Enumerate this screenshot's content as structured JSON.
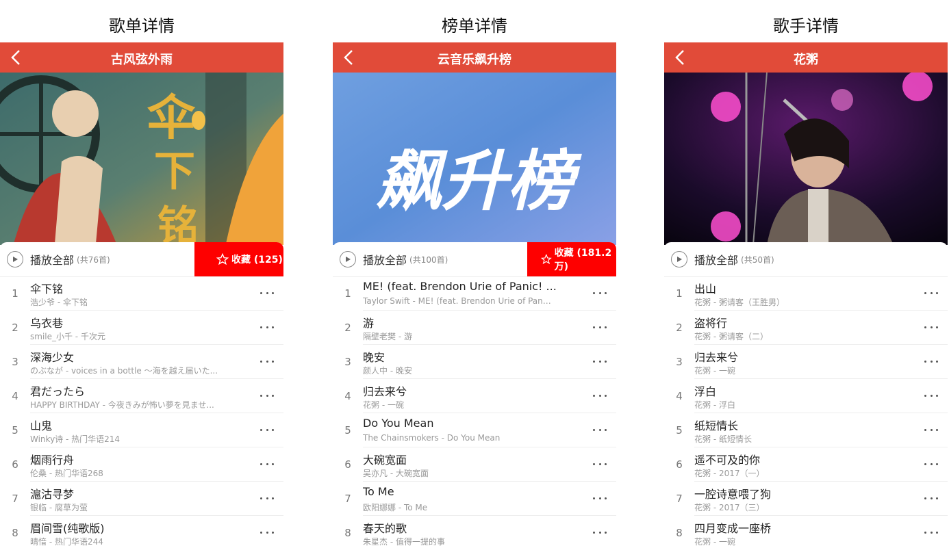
{
  "panels": [
    {
      "page_label": "歌单详情",
      "header_title": "古风弦外雨",
      "play_all_label": "播放全部",
      "count_text": "(共76首)",
      "collect_label": "收藏 (125)",
      "songs": [
        {
          "index": "1",
          "title": "伞下铭",
          "subtitle": "浩少爷 - 伞下铭"
        },
        {
          "index": "2",
          "title": "乌衣巷",
          "subtitle": "smile_小千 - 千次元"
        },
        {
          "index": "3",
          "title": "深海少女",
          "subtitle": "のぶなが - voices in a bottle ～海を越え届いた..."
        },
        {
          "index": "4",
          "title": "君だったら",
          "subtitle": "HAPPY BIRTHDAY - 今夜きみが怖い夢を見ませ..."
        },
        {
          "index": "5",
          "title": "山鬼",
          "subtitle": "Winky诗 - 热门华语214"
        },
        {
          "index": "6",
          "title": "烟雨行舟",
          "subtitle": "伦桑 - 热门华语268"
        },
        {
          "index": "7",
          "title": "滬沽寻梦",
          "subtitle": "银临 - 腐草为萤"
        },
        {
          "index": "8",
          "title": "眉间雪(纯歌版)",
          "subtitle": "晴愔 - 热门华语244"
        }
      ]
    },
    {
      "page_label": "榜单详情",
      "header_title": "云音乐飙升榜",
      "cover_text": "飙升榜",
      "play_all_label": "播放全部",
      "count_text": "(共100首)",
      "collect_label": "收藏 (181.2万)",
      "songs": [
        {
          "index": "1",
          "title": "ME! (feat. Brendon Urie of Panic! ...",
          "subtitle": "Taylor Swift - ME! (feat. Brendon Urie of Pani..."
        },
        {
          "index": "2",
          "title": "游",
          "subtitle": "隔壁老樊 - 游"
        },
        {
          "index": "3",
          "title": "晚安",
          "subtitle": "颜人中 - 晚安"
        },
        {
          "index": "4",
          "title": "归去来兮",
          "subtitle": "花粥 - 一碗"
        },
        {
          "index": "5",
          "title": "Do You Mean",
          "subtitle": "The Chainsmokers - Do You Mean"
        },
        {
          "index": "6",
          "title": "大碗宽面",
          "subtitle": "吴亦凡 - 大碗宽面"
        },
        {
          "index": "7",
          "title": "To Me",
          "subtitle": "欧阳娜娜 - To Me"
        },
        {
          "index": "8",
          "title": "春天的歌",
          "subtitle": "朱星杰 - 值得一提的事"
        }
      ]
    },
    {
      "page_label": "歌手详情",
      "header_title": "花粥",
      "play_all_label": "播放全部",
      "count_text": "(共50首)",
      "songs": [
        {
          "index": "1",
          "title": "出山",
          "subtitle": "花粥 - 粥请客（王胜男）"
        },
        {
          "index": "2",
          "title": "盗将行",
          "subtitle": "花粥 - 粥请客（二）"
        },
        {
          "index": "3",
          "title": "归去来兮",
          "subtitle": "花粥 - 一碗"
        },
        {
          "index": "4",
          "title": "浮白",
          "subtitle": "花粥 - 浮白"
        },
        {
          "index": "5",
          "title": "纸短情长",
          "subtitle": "花粥 - 纸短情长"
        },
        {
          "index": "6",
          "title": "遥不可及的你",
          "subtitle": "花粥 - 2017（一）"
        },
        {
          "index": "7",
          "title": "一腔诗意喂了狗",
          "subtitle": "花粥 - 2017（三）"
        },
        {
          "index": "8",
          "title": "四月变成一座桥",
          "subtitle": "花粥 - 一碗"
        }
      ]
    }
  ],
  "colors": {
    "header": "#e14b39",
    "collect": "#fe0000"
  },
  "icons": [
    "back-arrow-icon",
    "play-circle-icon",
    "star-icon",
    "more-dots-icon"
  ]
}
